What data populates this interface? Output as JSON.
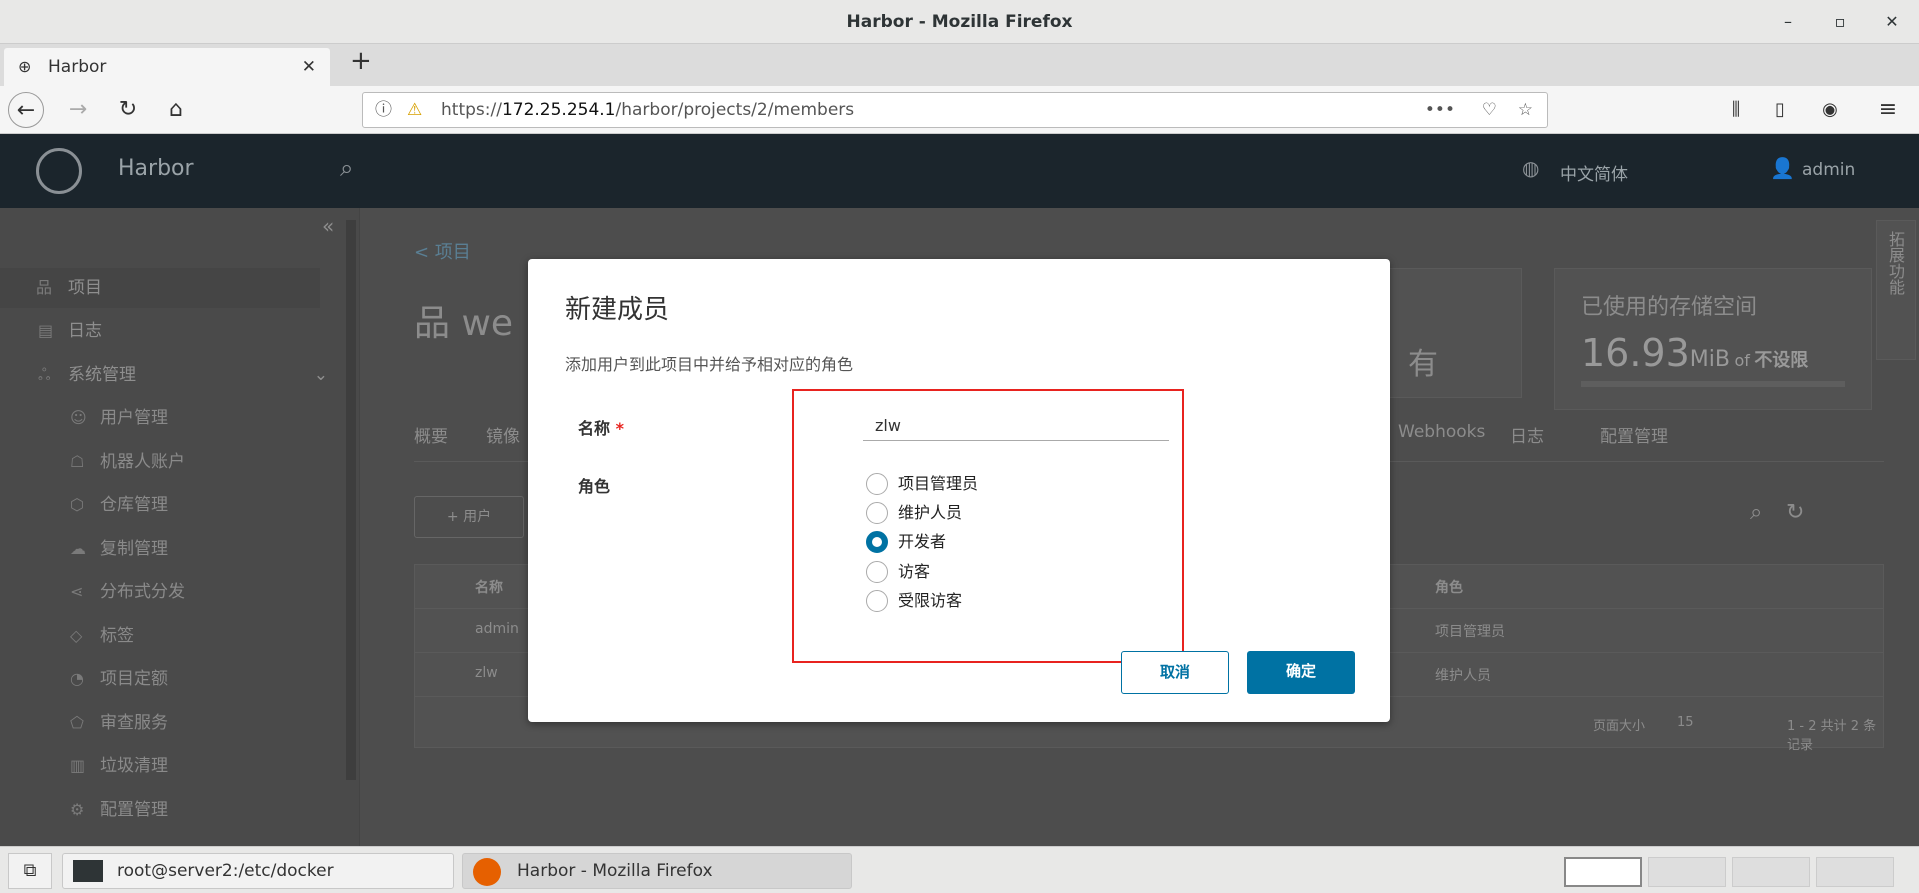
{
  "window": {
    "title": "Harbor - Mozilla Firefox",
    "min": "–",
    "max": "▫",
    "close": "✕"
  },
  "browser": {
    "tab_title": "Harbor",
    "tab_close": "✕",
    "new_tab": "+",
    "url_prefix": "https://",
    "url_host": "172.25.254.1",
    "url_path": "/harbor/projects/2/members",
    "more": "•••"
  },
  "header": {
    "brand": "Harbor",
    "language": "中文简体",
    "user": "admin"
  },
  "sidebar": {
    "collapse": "«",
    "items": [
      {
        "label": "项目",
        "icon": "project-icon"
      },
      {
        "label": "日志",
        "icon": "log-icon"
      },
      {
        "label": "系统管理",
        "icon": "admin-icon"
      }
    ],
    "sub_items": [
      {
        "label": "用户管理"
      },
      {
        "label": "机器人账户"
      },
      {
        "label": "仓库管理"
      },
      {
        "label": "复制管理"
      },
      {
        "label": "分布式分发"
      },
      {
        "label": "标签"
      },
      {
        "label": "项目定额"
      },
      {
        "label": "审查服务"
      },
      {
        "label": "垃圾清理"
      },
      {
        "label": "配置管理"
      }
    ]
  },
  "main": {
    "breadcrumb": "< 项目",
    "project_title": "we",
    "access_level": "有",
    "storage_label": "已使用的存储空间",
    "storage_value": "16.93",
    "storage_unit": "MiB",
    "storage_of": "of",
    "storage_limit": "不设限",
    "tabs": [
      "概要",
      "镜像",
      "Webhooks",
      "日志",
      "配置管理"
    ],
    "add_user": "+ 用户",
    "columns": [
      "名称",
      "角色"
    ],
    "rows": [
      {
        "name": "admin",
        "role": "项目管理员"
      },
      {
        "name": "zlw",
        "role": "维护人员"
      }
    ],
    "page_size_label": "页面大小",
    "page_size": "15",
    "pagination": "1 - 2 共计 2 条记录",
    "side_tab": "拓展功能"
  },
  "dialog": {
    "title": "新建成员",
    "subtitle": "添加用户到此项目中并给予相对应的角色",
    "name_label": "名称",
    "required": "*",
    "name_value": "zlw",
    "role_label": "角色",
    "roles": [
      {
        "label": "项目管理员",
        "selected": false
      },
      {
        "label": "维护人员",
        "selected": false
      },
      {
        "label": "开发者",
        "selected": true
      },
      {
        "label": "访客",
        "selected": false
      },
      {
        "label": "受限访客",
        "selected": false
      }
    ],
    "cancel": "取消",
    "ok": "确定"
  },
  "taskbar": {
    "items": [
      "root@server2:/etc/docker",
      "Harbor - Mozilla Firefox"
    ]
  },
  "colors": {
    "header": "#25343e",
    "primary": "#0072a3",
    "highlight": "#e8231f"
  }
}
